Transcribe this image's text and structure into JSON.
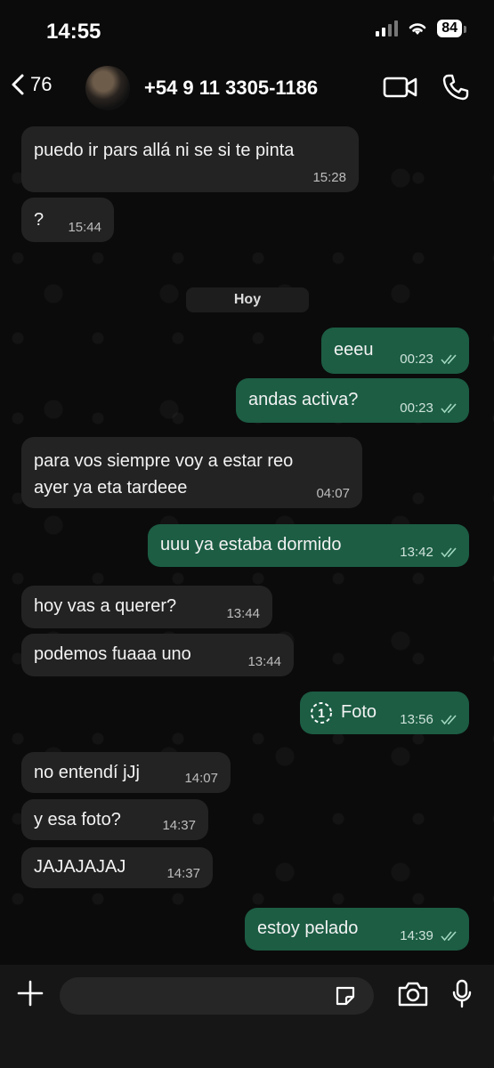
{
  "status_bar": {
    "time": "14:55",
    "battery": "84"
  },
  "header": {
    "back_count": "76",
    "contact_name": "+54 9 11 3305-1186"
  },
  "day_separator": "Hoy",
  "messages": [
    {
      "dir": "in",
      "text": "puedo ir pars allá ni se si te pinta",
      "time": "15:28"
    },
    {
      "dir": "in",
      "text": "?",
      "time": "15:44"
    },
    {
      "dir": "out",
      "text": "eeeu",
      "time": "00:23"
    },
    {
      "dir": "out",
      "text": "andas activa?",
      "time": "00:23"
    },
    {
      "dir": "in",
      "text": "para vos siempre voy a estar reo",
      "text2": "ayer ya eta tardeee",
      "time": "04:07"
    },
    {
      "dir": "out",
      "text": "uuu ya estaba dormido",
      "time": "13:42"
    },
    {
      "dir": "in",
      "text": "hoy vas a querer?",
      "time": "13:44"
    },
    {
      "dir": "in",
      "text": "podemos fuaaa uno",
      "time": "13:44"
    },
    {
      "dir": "out",
      "text": "Foto",
      "time": "13:56",
      "view_once": "1"
    },
    {
      "dir": "in",
      "text": "no entendí jJj",
      "time": "14:07"
    },
    {
      "dir": "in",
      "text": "y esa foto?",
      "time": "14:37"
    },
    {
      "dir": "in",
      "text": "JAJAJAJAJ",
      "time": "14:37"
    },
    {
      "dir": "out",
      "text": "estoy pelado",
      "time": "14:39"
    }
  ],
  "input": {
    "placeholder": ""
  },
  "colors": {
    "incoming": "#232323",
    "outgoing": "#1c5d44",
    "read_ticks": "#9fd6bd"
  }
}
